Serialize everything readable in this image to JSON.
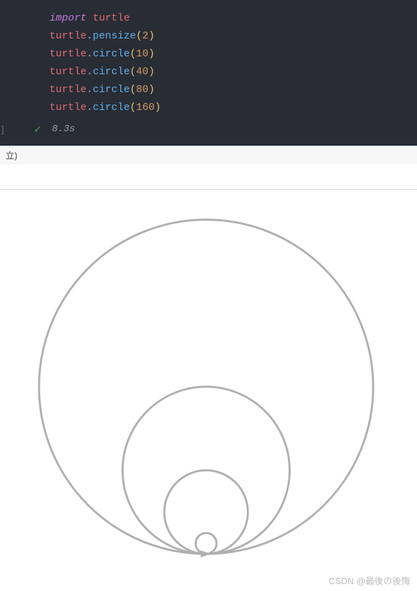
{
  "code": {
    "lines": [
      {
        "tokens": [
          {
            "cls": "k-import",
            "t": "import"
          },
          {
            "cls": "",
            "t": " "
          },
          {
            "cls": "k-module",
            "t": "turtle"
          }
        ]
      },
      {
        "tokens": [
          {
            "cls": "k-object",
            "t": "turtle"
          },
          {
            "cls": "k-dot",
            "t": "."
          },
          {
            "cls": "k-method",
            "t": "pensize"
          },
          {
            "cls": "k-paren",
            "t": "("
          },
          {
            "cls": "k-num",
            "t": "2"
          },
          {
            "cls": "k-paren",
            "t": ")"
          }
        ]
      },
      {
        "tokens": [
          {
            "cls": "k-object",
            "t": "turtle"
          },
          {
            "cls": "k-dot",
            "t": "."
          },
          {
            "cls": "k-method",
            "t": "circle"
          },
          {
            "cls": "k-paren",
            "t": "("
          },
          {
            "cls": "k-num",
            "t": "10"
          },
          {
            "cls": "k-paren",
            "t": ")"
          }
        ]
      },
      {
        "tokens": [
          {
            "cls": "k-object",
            "t": "turtle"
          },
          {
            "cls": "k-dot",
            "t": "."
          },
          {
            "cls": "k-method",
            "t": "circle"
          },
          {
            "cls": "k-paren",
            "t": "("
          },
          {
            "cls": "k-num",
            "t": "40"
          },
          {
            "cls": "k-paren",
            "t": ")"
          }
        ]
      },
      {
        "tokens": [
          {
            "cls": "k-object",
            "t": "turtle"
          },
          {
            "cls": "k-dot",
            "t": "."
          },
          {
            "cls": "k-method",
            "t": "circle"
          },
          {
            "cls": "k-paren",
            "t": "("
          },
          {
            "cls": "k-num",
            "t": "80"
          },
          {
            "cls": "k-paren",
            "t": ")"
          }
        ]
      },
      {
        "tokens": [
          {
            "cls": "k-object",
            "t": "turtle"
          },
          {
            "cls": "k-dot",
            "t": "."
          },
          {
            "cls": "k-method",
            "t": "circle"
          },
          {
            "cls": "k-paren",
            "t": "("
          },
          {
            "cls": "k-num",
            "t": "160"
          },
          {
            "cls": "k-paren",
            "t": ")"
          }
        ]
      }
    ]
  },
  "execution": {
    "bracket": "]",
    "status": "success",
    "time_label": "8.3s"
  },
  "output": {
    "header_fragment": "立)"
  },
  "watermark": "CSDN @最後の後悔",
  "chart_data": {
    "type": "turtle-circles",
    "pensize": 2,
    "radii": [
      10,
      40,
      80,
      160
    ],
    "stroke_color": "#b0b0b0",
    "tangent_point": "bottom"
  }
}
